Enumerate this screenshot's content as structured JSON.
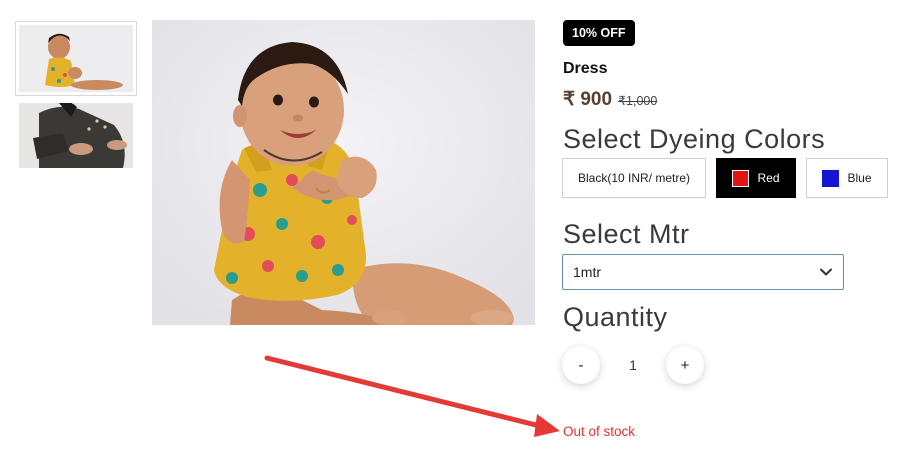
{
  "gallery": {
    "thumbnails": [
      "baby-dress-thumb",
      "kurti-thumb"
    ],
    "main_image": "baby-dress-main"
  },
  "product": {
    "badge": "10% OFF",
    "name": "Dress",
    "price": "₹ 900",
    "old_price": "₹1,000"
  },
  "colors": {
    "title": "Select Dyeing Colors",
    "options": [
      {
        "label": "Black(10 INR/ metre)",
        "swatch": null,
        "selected": false
      },
      {
        "label": "Red",
        "swatch": "#e41414",
        "selected": true
      },
      {
        "label": "Blue",
        "swatch": "#1414d4",
        "selected": false
      }
    ]
  },
  "meter": {
    "title": "Select Mtr",
    "selected": "1mtr"
  },
  "quantity": {
    "title": "Quantity",
    "minus": "-",
    "value": "1",
    "plus": "+"
  },
  "stock_status": "Out of stock",
  "annotation": {
    "color": "#e53935"
  }
}
